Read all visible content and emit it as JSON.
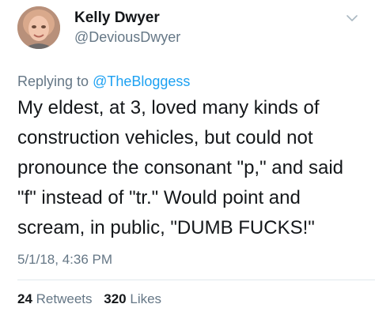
{
  "author": {
    "name": "Kelly Dwyer",
    "handle": "@DeviousDwyer"
  },
  "reply": {
    "prefix": "Replying to ",
    "mention": "@TheBloggess"
  },
  "tweet": {
    "lines": [
      "My eldest, at 3, loved many kinds of",
      "construction vehicles, but could not",
      "pronounce the consonant \"p,\" and said",
      "\"f\" instead of \"tr.\" Would point and",
      "scream, in public, \"DUMB FUCKS!\""
    ],
    "timestamp": "5/1/18, 4:36 PM"
  },
  "stats": {
    "retweets_count": "24",
    "retweets_label": "Retweets",
    "likes_count": "320",
    "likes_label": "Likes"
  },
  "colors": {
    "text": "#14171a",
    "secondary": "#657786",
    "link": "#1da1f2",
    "divider": "#e1e8ed"
  },
  "icons": {
    "menu": "chevron-down-icon"
  }
}
